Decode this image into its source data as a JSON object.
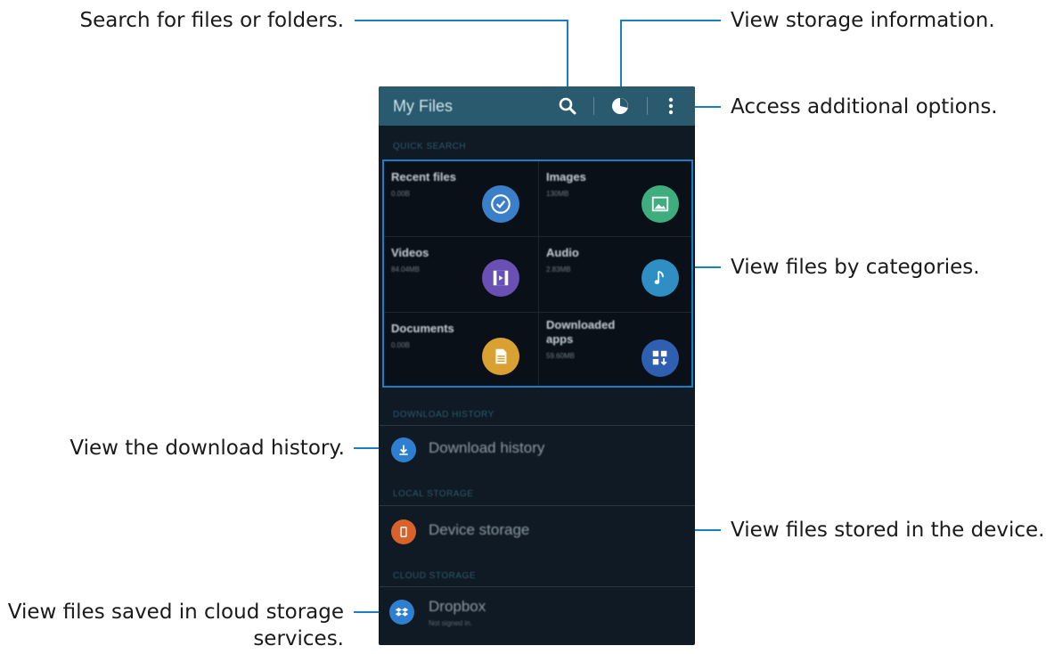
{
  "callouts": {
    "search": "Search for files or folders.",
    "storage_info": "View storage information.",
    "more_options": "Access additional options.",
    "categories": "View files by categories.",
    "download_history": "View the download history.",
    "device_storage": "View files stored in the device.",
    "cloud_line1": "View files saved in cloud storage",
    "cloud_line2": "services."
  },
  "appbar": {
    "title": "My Files",
    "icons": [
      "search-icon",
      "pie-chart-icon",
      "more-vert-icon"
    ]
  },
  "sections": {
    "quick_search": "QUICK SEARCH",
    "download_history": "DOWNLOAD HISTORY",
    "local_storage": "LOCAL STORAGE",
    "cloud_storage": "CLOUD STORAGE"
  },
  "categories": [
    {
      "title": "Recent files",
      "sub": "0.00B",
      "icon": "clock-check-icon",
      "color": "#3b7fc9"
    },
    {
      "title": "Images",
      "sub": "130MB",
      "icon": "image-icon",
      "color": "#3fae7e"
    },
    {
      "title": "Videos",
      "sub": "84.04MB",
      "icon": "film-icon",
      "color": "#6a4fb4"
    },
    {
      "title": "Audio",
      "sub": "2.83MB",
      "icon": "music-note-icon",
      "color": "#2f8fc4"
    },
    {
      "title": "Documents",
      "sub": "0.00B",
      "icon": "document-icon",
      "color": "#d9a032"
    },
    {
      "title": "Downloaded apps",
      "sub": "59.60MB",
      "icon": "apps-download-icon",
      "color": "#2e5fb0"
    }
  ],
  "list": {
    "download_history": {
      "label": "Download history",
      "icon": "download-icon",
      "color": "#2f7fd1"
    },
    "device_storage": {
      "label": "Device storage",
      "icon": "phone-icon",
      "color": "#d9622a"
    },
    "dropbox": {
      "label": "Dropbox",
      "sub": "Not signed in.",
      "icon": "dropbox-icon",
      "color": "#2f7fd1"
    }
  },
  "colors": {
    "callout_line": "#1a7fc4",
    "appbar": "#2a5a6e",
    "background": "#0f1a24"
  }
}
